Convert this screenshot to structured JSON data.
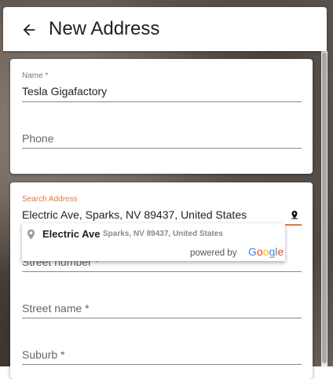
{
  "header": {
    "back_icon": "arrow-left-icon",
    "title": "New Address"
  },
  "card1": {
    "name": {
      "label": "Name *",
      "value": "Tesla Gigafactory"
    },
    "phone": {
      "placeholder": "Phone"
    }
  },
  "card2": {
    "search": {
      "label": "Search Address",
      "value": "Electric Ave, Sparks, NV 89437, United States",
      "icon": "map-pin-icon"
    },
    "street_number": {
      "placeholder": "Street number *"
    },
    "street_name": {
      "placeholder": "Street name *"
    },
    "suburb": {
      "placeholder": "Suburb *"
    }
  },
  "autocomplete": {
    "item": {
      "icon": "map-marker-icon",
      "main_text": "Electric Ave",
      "secondary_text": "Sparks, NV 89437, United States"
    },
    "powered_by": "powered by",
    "brand": "Google"
  },
  "colors": {
    "accent": "#e8763a",
    "google_blue": "#4285f4",
    "google_red": "#ea4335",
    "google_yellow": "#fbbc05",
    "google_green": "#34a853"
  }
}
